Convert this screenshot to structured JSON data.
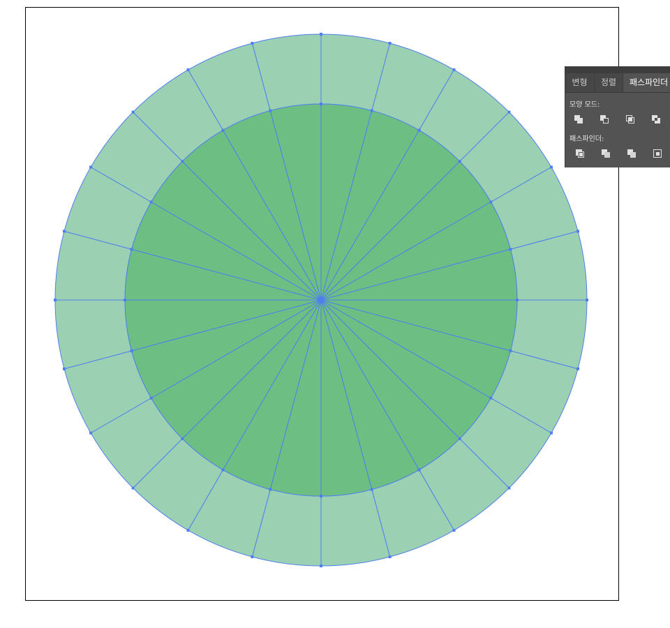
{
  "artboard": {
    "border_color": "#000000"
  },
  "colors": {
    "outer_ring_fill": "#9bd0b3",
    "inner_disc_fill": "#6dbe83",
    "selection_path": "#4f7fef"
  },
  "artwork": {
    "segment_count": 24
  },
  "pathfinder_panel": {
    "tabs": [
      {
        "label": "변형",
        "active": false
      },
      {
        "label": "정렬",
        "active": false
      },
      {
        "label": "패스파인더",
        "active": true
      }
    ],
    "shape_modes_label": "모양 모드:",
    "pathfinders_label": "패스파인더:",
    "shape_mode_icons": [
      "unite-icon",
      "minus-front-icon",
      "intersect-icon",
      "exclude-icon"
    ],
    "pathfinder_icons": [
      "divide-icon",
      "trim-icon",
      "merge-icon",
      "crop-icon"
    ]
  }
}
